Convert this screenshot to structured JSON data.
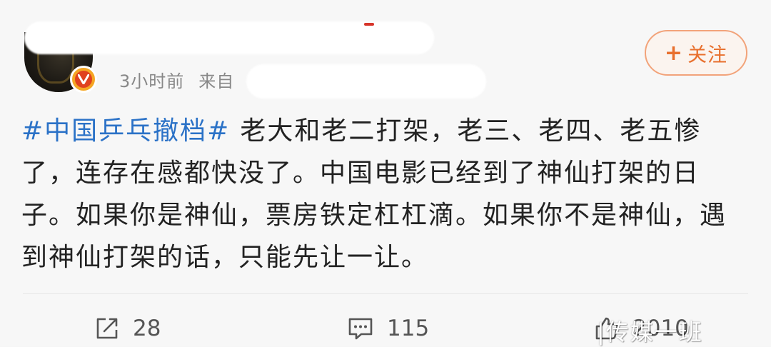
{
  "header": {
    "time": "3小时前",
    "source_prefix": "来自"
  },
  "follow_button": {
    "plus": "+",
    "label": "关注"
  },
  "post": {
    "hashtag": "#中国乒乓撤档#",
    "text": "老大和老二打架，老三、老四、老五惨了，连存在感都快没了。中国电影已经到了神仙打架的日子。如果你是神仙，票房铁定杠杠滴。如果你不是神仙，遇到神仙打架的话，只能先让一让。"
  },
  "actions": {
    "share_count": "28",
    "comment_count": "115",
    "like_count": "2010"
  },
  "watermark": "|传媒一班",
  "colors": {
    "link": "#2b72c7",
    "accent_orange": "#e8702e",
    "badge_orange": "#f5a623"
  },
  "icons": {
    "share": "share-icon",
    "comment": "comment-icon",
    "like": "thumbs-up-icon",
    "verified": "verified-badge-icon"
  }
}
